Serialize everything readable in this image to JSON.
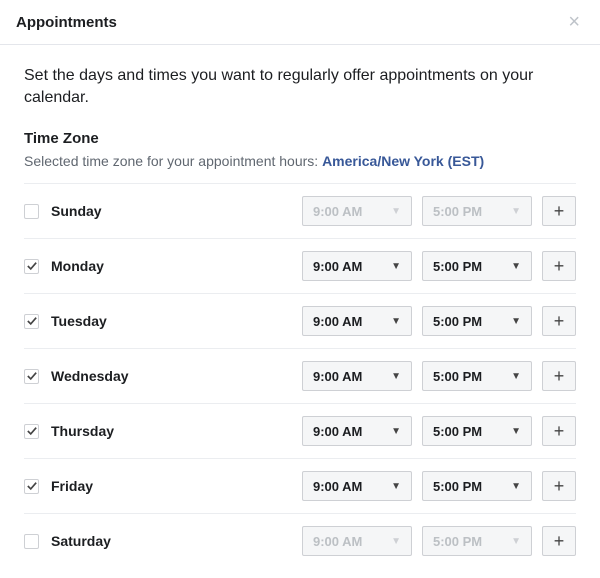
{
  "header": {
    "title": "Appointments"
  },
  "description": "Set the days and times you want to regularly offer appointments on your calendar.",
  "timezone": {
    "section_title": "Time Zone",
    "prefix": "Selected time zone for your appointment hours: ",
    "link": "America/New York (EST)"
  },
  "days": [
    {
      "name": "Sunday",
      "checked": false,
      "start": "9:00 AM",
      "end": "5:00 PM"
    },
    {
      "name": "Monday",
      "checked": true,
      "start": "9:00 AM",
      "end": "5:00 PM"
    },
    {
      "name": "Tuesday",
      "checked": true,
      "start": "9:00 AM",
      "end": "5:00 PM"
    },
    {
      "name": "Wednesday",
      "checked": true,
      "start": "9:00 AM",
      "end": "5:00 PM"
    },
    {
      "name": "Thursday",
      "checked": true,
      "start": "9:00 AM",
      "end": "5:00 PM"
    },
    {
      "name": "Friday",
      "checked": true,
      "start": "9:00 AM",
      "end": "5:00 PM"
    },
    {
      "name": "Saturday",
      "checked": false,
      "start": "9:00 AM",
      "end": "5:00 PM"
    }
  ]
}
